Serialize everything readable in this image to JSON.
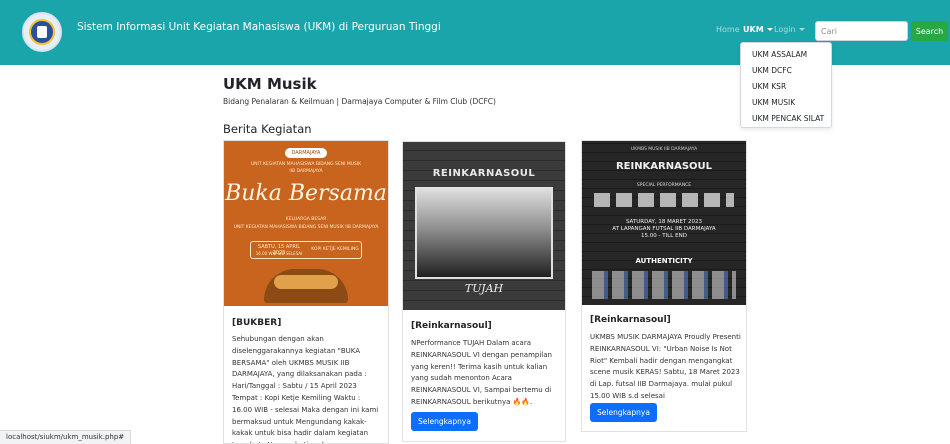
{
  "navbar": {
    "brand": "Sistem Informasi Unit Kegiatan Mahasiswa (UKM) di Perguruan Tinggi",
    "home": "Home",
    "ukm": "UKM",
    "login": "Login",
    "search_placeholder": "Cari",
    "search_button": "Search"
  },
  "dropdown": {
    "items": [
      "UKM ASSALAM",
      "UKM DCFC",
      "UKM KSR",
      "UKM MUSIK",
      "UKM PENCAK SILAT"
    ]
  },
  "page": {
    "title": "UKM Musik",
    "subtitle": "Bidang Penalaran & Keilmuan | Darmajaya Computer & Film Club (DCFC)",
    "section": "Berita Kegiatan"
  },
  "cards": [
    {
      "title": "[BUKBER]",
      "text": "Sehubungan dengan akan diselenggarakannya kegiatan \"BUKA BERSAMA\" oleh UKMBS MUSIK IIB DARMAJAYA, yang dilaksanakan pada : Hari/Tanggal : Sabtu / 15 April 2023 Tempat : Kopi Ketje Kemiling Waktu : 16.00 WIB - selesai Maka dengan ini kami bermaksud untuk Mengundang kakak-kakak untuk bisa hadir dalam kegiatan tersebut. Atas perhatian dan kerjasamanya",
      "poster": {
        "badge": "DARMAJAYA",
        "line1": "UNIT KEGIATAN MAHASISWA BIDANG SENI MUSIK",
        "line2": "IIB DARMAJAYA",
        "main": "Buka Bersama",
        "family": "KELUARGA BESAR",
        "org": "UNIT KEGIATAN MAHASISWA BIDANG SENI MUSIK IIB DARMAJAYA",
        "date": "SABTU, 15 APRIL 2023",
        "time": "16.00 WIB S/D SELESAI",
        "place": "KOPI KETJE KEMILING"
      }
    },
    {
      "title": "[Reinkarnasoul]",
      "text": "NPerformance TUJAH Dalam acara REINKARNASOUL VI dengan penampilan yang keren!! Terima kasih untuk kalian yang sudah menonton Acara REINKARNASOUL VI, Sampai bertemu di REINKARNASOUL berikutnya 🔥🔥.",
      "button": "Selengkapnya",
      "poster": {
        "title": "REINKARNASOUL",
        "band": "TUJAH"
      }
    },
    {
      "title": "[Reinkarnasoul]",
      "text": "UKMBS MUSIK DARMAJAYA Proudly Presenti REINKARNASOUL VI: \"Urban Noise Is Not Riot\" Kembali hadir dengan mengangkat scene musik KERAS! Sabtu, 18 Maret 2023 di Lap. futsal IIB Darmajaya. mulai pukul 15.00 WIB s.d selesai",
      "button": "Selengkapnya",
      "poster": {
        "head": "UKMBS MUSIK IIB DARMAJAYA",
        "title": "REINKARNASOUL",
        "special": "SPECIAL PERFORMANCE",
        "date": "SATURDAY, 18 MARET 2023",
        "place": "AT LAPANGAN FUTSAL IIB DARMAJAYA",
        "time": "15.00 - TILL END",
        "sponsor": "AUTHENTICITY"
      }
    }
  ],
  "status_bar": "localhost/siukm/ukm_musik.php#",
  "colors": {
    "navbar": "#1aa5aa",
    "search_button": "#28a745",
    "primary_button": "#0d6efd"
  }
}
